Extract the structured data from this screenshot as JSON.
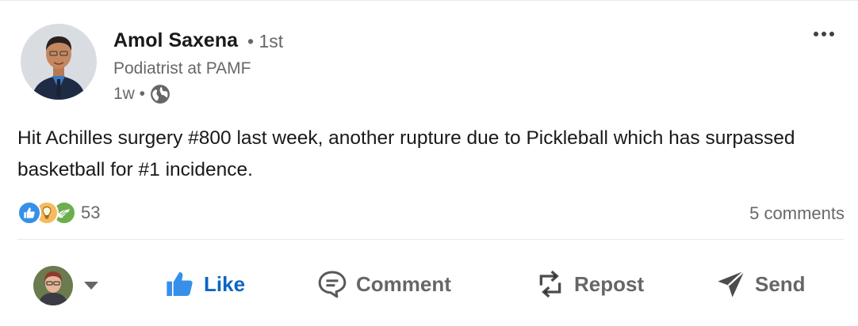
{
  "post": {
    "author": {
      "name": "Amol Saxena",
      "degree": "• 1st",
      "headline": "Podiatrist at PAMF",
      "time": "1w •",
      "visibility_icon": "globe-icon"
    },
    "menu_icon": "more-horizontal-icon",
    "text": "Hit Achilles surgery #800 last week, another rupture due to Pickleball which has surpassed basketball for #1 incidence.",
    "reactions": {
      "icons": [
        "like-reaction-icon",
        "insightful-reaction-icon",
        "support-reaction-icon"
      ],
      "count": "53"
    },
    "comments_label": "5 comments"
  },
  "actions": {
    "like": "Like",
    "comment": "Comment",
    "repost": "Repost",
    "send": "Send"
  },
  "colors": {
    "accent": "#0a66c2",
    "like_reaction": "#378fe9",
    "insight_reaction": "#f5bb5c",
    "support_reaction": "#6dae4f"
  }
}
